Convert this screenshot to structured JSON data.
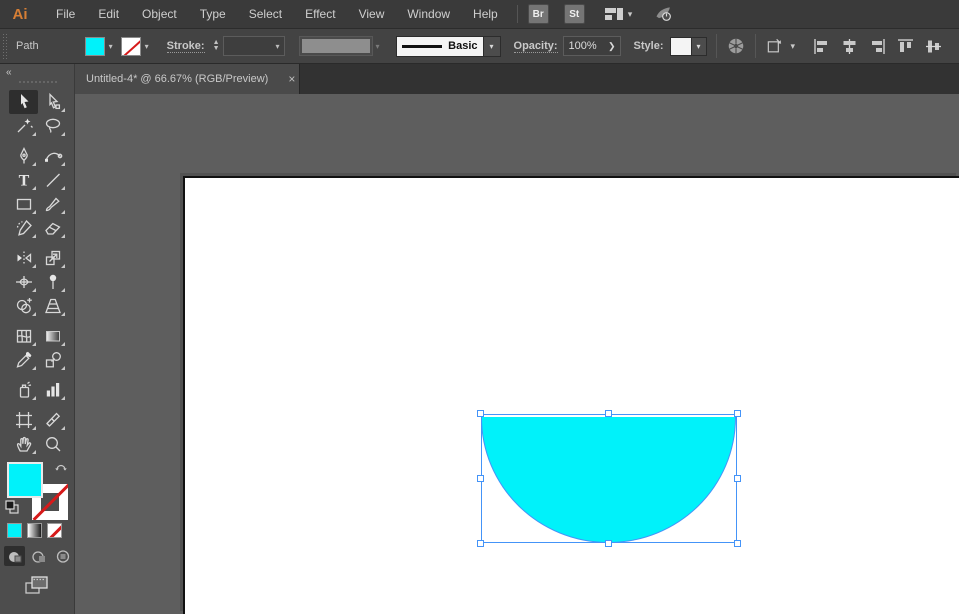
{
  "menubar": {
    "logo": "Ai",
    "items": [
      "File",
      "Edit",
      "Object",
      "Type",
      "Select",
      "Effect",
      "View",
      "Window",
      "Help"
    ],
    "quick_buttons": [
      {
        "label": "Br",
        "name": "bridge-button"
      },
      {
        "label": "St",
        "name": "stock-button"
      }
    ],
    "workspace_icon": "workspace-switcher-icon",
    "gpu_icon": "gpu-performance-icon"
  },
  "control_bar": {
    "selection_type_label": "Path",
    "fill_swatch": "cyan",
    "stroke_swatch": "none",
    "stroke_label": "Stroke:",
    "stroke_weight_value": "",
    "brush_definition": "Basic",
    "opacity_label": "Opacity:",
    "opacity_value": "100%",
    "style_label": "Style:",
    "align_tools": [
      "horizontal-align-left",
      "horizontal-align-center",
      "horizontal-align-right",
      "vertical-align-top",
      "vertical-align-center"
    ]
  },
  "document_tab": {
    "title": "Untitled-4* @ 66.67% (RGB/Preview)",
    "close_label": "×"
  },
  "toolbar": {
    "collapse_label": "«",
    "tools": [
      {
        "name": "selection",
        "active": true
      },
      {
        "name": "direct-selection"
      },
      {
        "name": "magic-wand"
      },
      {
        "name": "lasso"
      },
      {
        "name": "pen"
      },
      {
        "name": "curvature"
      },
      {
        "name": "type"
      },
      {
        "name": "line-segment"
      },
      {
        "name": "rectangle"
      },
      {
        "name": "paintbrush"
      },
      {
        "name": "shaper"
      },
      {
        "name": "eraser"
      },
      {
        "name": "reflect"
      },
      {
        "name": "scale"
      },
      {
        "name": "width"
      },
      {
        "name": "puppet-warp"
      },
      {
        "name": "shape-builder"
      },
      {
        "name": "perspective-grid"
      },
      {
        "name": "mesh"
      },
      {
        "name": "gradient"
      },
      {
        "name": "eyedropper"
      },
      {
        "name": "blend"
      },
      {
        "name": "symbol-sprayer"
      },
      {
        "name": "column-graph"
      },
      {
        "name": "artboard"
      },
      {
        "name": "slice"
      },
      {
        "name": "hand"
      },
      {
        "name": "zoom"
      }
    ],
    "fill_indicator": "cyan",
    "stroke_indicator": "none",
    "swatches": [
      "color",
      "gradient",
      "none"
    ],
    "drawing_modes": [
      "draw-normal",
      "draw-behind",
      "draw-inside"
    ],
    "screen_mode": "change-screen-mode"
  },
  "artboard": {
    "shape": {
      "type": "semicircle",
      "fill_color": "cyan",
      "selected": true,
      "handles": 8
    }
  },
  "colors": {
    "fill_cyan": "#00f2fa",
    "selection_blue": "#4494f8",
    "logo_orange": "#d77f35"
  }
}
